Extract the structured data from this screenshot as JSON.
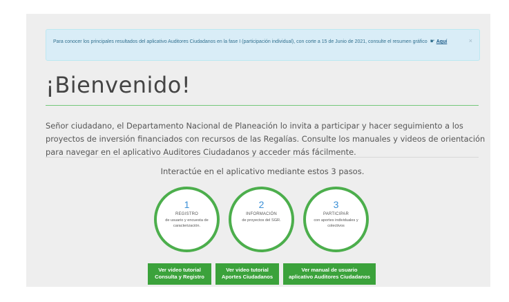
{
  "alert": {
    "text": "Para conocer los principales resultados del aplicativo Auditores Ciudadanos en la fase I (participación individual), con corte a 15 de Junio de 2021, consulte el resumen gráfico",
    "link_label": "Aquí",
    "close_label": "×"
  },
  "title": "¡Bienvenido!",
  "intro": "Señor ciudadano, el Departamento Nacional de Planeación lo invita a participar y hacer seguimiento a los proyectos de inversión financiados con recursos de las Regalías. Consulte los manuales y videos de orientación para navegar en el aplicativo Auditores Ciudadanos y acceder más fácilmente.",
  "steps_heading": "Interactúe en el aplicativo mediante estos 3 pasos.",
  "steps": [
    {
      "number": "1",
      "label": "REGISTRO",
      "desc": "de usuario y encuesta de caracterización."
    },
    {
      "number": "2",
      "label": "INFORMACIÓN",
      "desc": "de proyectos del SGR."
    },
    {
      "number": "3",
      "label": "PARTICIPAR",
      "desc": "con aportes individuales y colectivos"
    }
  ],
  "buttons": [
    {
      "line1": "Ver video tutorial",
      "line2": "Consulta y Registro"
    },
    {
      "line1": "Ver video tutorial",
      "line2": "Aportes Ciudadanos"
    },
    {
      "line1": "Ver manual de usuario",
      "line2": "aplicativo Auditores Ciudadanos"
    }
  ],
  "colors": {
    "accent_green": "#3ba23b",
    "step_number_blue": "#3a8fd6",
    "alert_bg": "#d9edf7"
  }
}
